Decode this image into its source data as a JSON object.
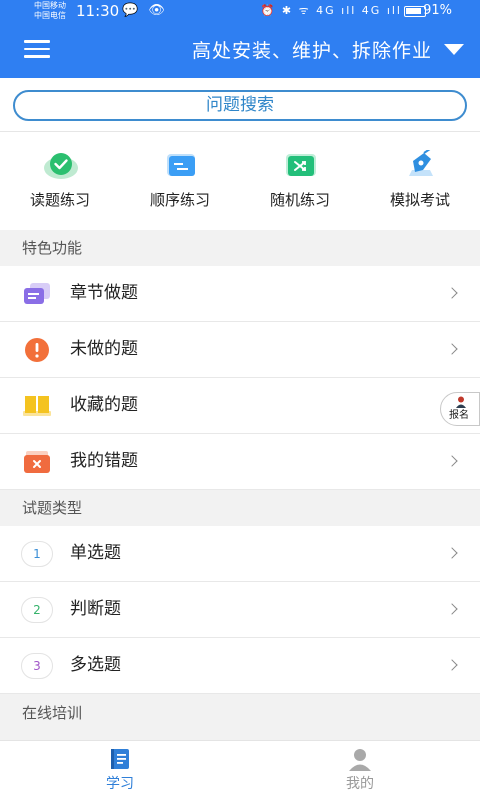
{
  "status_bar": {
    "carrier_1": "中国移动",
    "carrier_2": "中国电信",
    "time": "11:30",
    "left_icons": "💬 👁",
    "right_icons": "⏰ ✱ ᯤ 4G ıll 4G ıll",
    "battery": "91%"
  },
  "header": {
    "title": "高处安装、维护、拆除作业",
    "menu_icon": "hamburger-icon",
    "dropdown_icon": "caret-down-icon"
  },
  "search": {
    "label": "问题搜索"
  },
  "quick_actions": [
    {
      "label": "读题练习",
      "icon": "check-circle-icon",
      "color": "#2bbf6f"
    },
    {
      "label": "顺序练习",
      "icon": "list-icon",
      "color": "#3b9ef5"
    },
    {
      "label": "随机练习",
      "icon": "shuffle-icon",
      "color": "#23bf7a"
    },
    {
      "label": "模拟考试",
      "icon": "pen-icon",
      "color": "#2f8fe0"
    }
  ],
  "features_section": {
    "title": "特色功能",
    "items": [
      {
        "label": "章节做题",
        "icon": "chapter-icon",
        "color": "#8a6ee6"
      },
      {
        "label": "未做的题",
        "icon": "exclamation-icon",
        "color": "#f2703a"
      },
      {
        "label": "收藏的题",
        "icon": "book-icon",
        "color": "#f4c320"
      },
      {
        "label": "我的错题",
        "icon": "wrong-icon",
        "color": "#f06b3f"
      }
    ]
  },
  "types_section": {
    "title": "试题类型",
    "items": [
      {
        "number": "1",
        "label": "单选题",
        "color": "#3a8ed6"
      },
      {
        "number": "2",
        "label": "判断题",
        "color": "#35b36b"
      },
      {
        "number": "3",
        "label": "多选题",
        "color": "#a055c8"
      }
    ]
  },
  "training_section": {
    "title": "在线培训"
  },
  "floating_button": {
    "label": "报名"
  },
  "tabbar": {
    "tabs": [
      {
        "label": "学习",
        "icon": "study-book-icon",
        "active": true,
        "color": "#2f7fd8"
      },
      {
        "label": "我的",
        "icon": "user-icon",
        "active": false,
        "color": "#999999"
      }
    ]
  }
}
